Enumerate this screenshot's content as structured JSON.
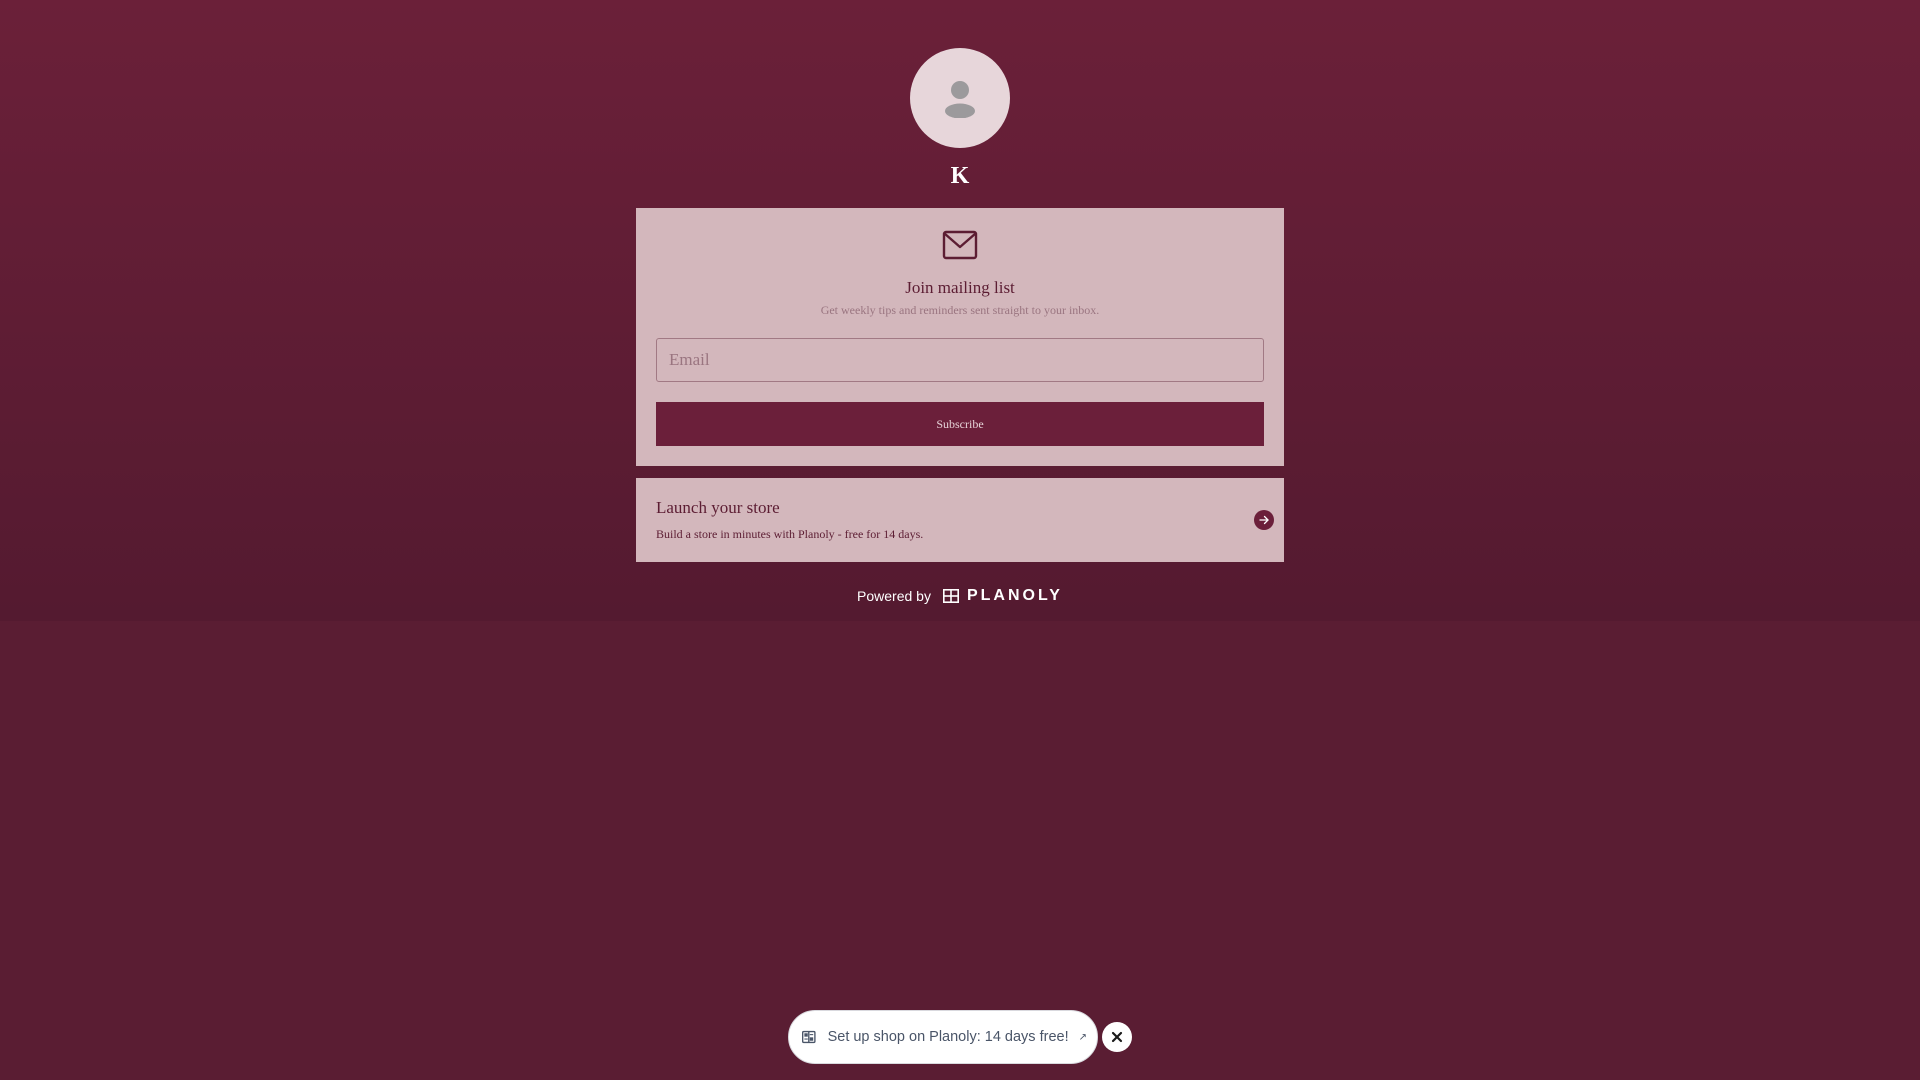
{
  "profile": {
    "name": "K",
    "avatar_icon": "user-icon"
  },
  "mailing": {
    "icon": "envelope-icon",
    "title": "Join mailing list",
    "subtitle": "Get weekly tips and reminders sent straight to your inbox.",
    "email_placeholder": "Email",
    "email_value": "",
    "subscribe_label": "Subscribe"
  },
  "store": {
    "title": "Launch your store",
    "description": "Build a store in minutes with Planoly - free for 14 days.",
    "arrow_icon": "arrow-right-icon"
  },
  "footer": {
    "powered_by": "Powered by",
    "brand": "PLANOLY"
  },
  "promo": {
    "text": "Set up shop on Planoly: 14 days free!",
    "external_icon": "↗",
    "close_icon": "close-icon"
  },
  "colors": {
    "background": "#5a1d33",
    "card": "#d3b7bc",
    "accent": "#6b1f3a",
    "text_dark": "#5c1d33"
  }
}
